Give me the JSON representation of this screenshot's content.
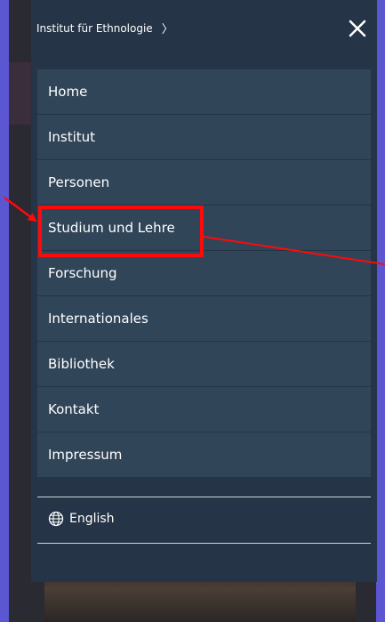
{
  "header": {
    "breadcrumb": "Institut für Ethnologie",
    "breadcrumb_chevron": "〉",
    "close_icon": "close-icon"
  },
  "menu": {
    "items": [
      {
        "label": "Home"
      },
      {
        "label": "Institut"
      },
      {
        "label": "Personen"
      },
      {
        "label": "Studium und Lehre"
      },
      {
        "label": "Forschung"
      },
      {
        "label": "Internationales"
      },
      {
        "label": "Bibliothek"
      },
      {
        "label": "Kontakt"
      },
      {
        "label": "Impressum"
      }
    ]
  },
  "language": {
    "label": "English",
    "icon": "globe-icon"
  },
  "colors": {
    "panel": "#253446",
    "item": "#314559",
    "annotation": "#ff0a0a",
    "outer_bg": "#5b56d2"
  }
}
